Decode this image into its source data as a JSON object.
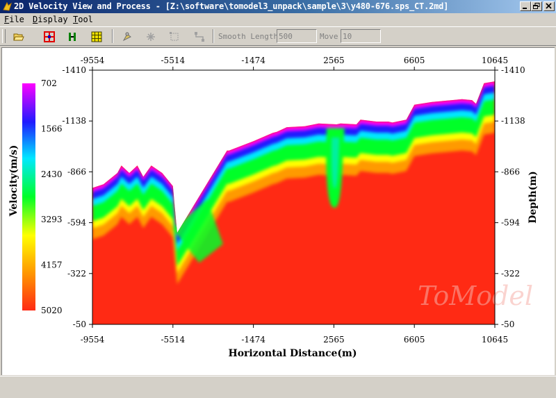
{
  "window": {
    "title": "2D Velocity View and Process - [Z:\\software\\tomodel3_unpack\\sample\\3\\y480-676.sps_CT.2md]"
  },
  "menu": [
    {
      "accel": "F",
      "rest": "ile"
    },
    {
      "accel": "D",
      "rest": "isplay"
    },
    {
      "accel": "T",
      "rest": "ool"
    }
  ],
  "toolbar": {
    "smooth_length_label": "Smooth Length",
    "smooth_length_value": "500",
    "move_label": "Move",
    "move_value": "10",
    "icons": [
      "open-folder-icon",
      "crosshair-grid-icon",
      "vertical-bars-icon",
      "grid-icon",
      "pick-tool-icon",
      "star-tool-icon",
      "select-box-icon",
      "node-edit-icon"
    ]
  },
  "watermark": "ToModel",
  "colors": {
    "background": "#d4d0c8",
    "title_bar": "#0a246a",
    "high_velocity": "#ff2a14",
    "low_velocity": "#ff00ff"
  },
  "chart_data": {
    "type": "heatmap",
    "title": "",
    "xlabel": "Horizontal Distance(m)",
    "ylabel": "Depth(m)",
    "colorbar_label": "Velocity(m/s)",
    "xlim": [
      -9554,
      10645
    ],
    "ylim": [
      -1410,
      -50
    ],
    "x_ticks": [
      -9554,
      -5514,
      -1474,
      2565,
      6605,
      10645
    ],
    "y_ticks": [
      -1410,
      -1138,
      -866,
      -594,
      -322,
      -50
    ],
    "colorbar": {
      "range": [
        702,
        5020
      ],
      "ticks": [
        702,
        1566,
        2430,
        3293,
        4157,
        5020
      ],
      "colors": [
        "#ff00ff",
        "#1f1aff",
        "#00e8ff",
        "#00ff28",
        "#ffff00",
        "#ff9a00",
        "#ff2a14"
      ]
    },
    "surface_profile": {
      "x": [
        -9554,
        -9000,
        -8300,
        -8100,
        -7700,
        -7300,
        -7000,
        -6600,
        -6050,
        -5514,
        -5300,
        -2800,
        -2700,
        -1474,
        -500,
        -300,
        200,
        1100,
        1800,
        2700,
        2900,
        3700,
        3900,
        4700,
        4900,
        5300,
        5500,
        6200,
        6605,
        7500,
        8500,
        9000,
        9500,
        9700,
        10100,
        10645
      ],
      "depth": [
        -780,
        -800,
        -860,
        -900,
        -860,
        -900,
        -840,
        -900,
        -860,
        -790,
        -540,
        -980,
        -980,
        -1030,
        -1075,
        -1080,
        -1105,
        -1110,
        -1125,
        -1120,
        -1125,
        -1120,
        -1145,
        -1135,
        -1135,
        -1135,
        -1130,
        -1145,
        -1225,
        -1240,
        -1250,
        -1255,
        -1250,
        -1230,
        -1340,
        -1350
      ]
    }
  }
}
